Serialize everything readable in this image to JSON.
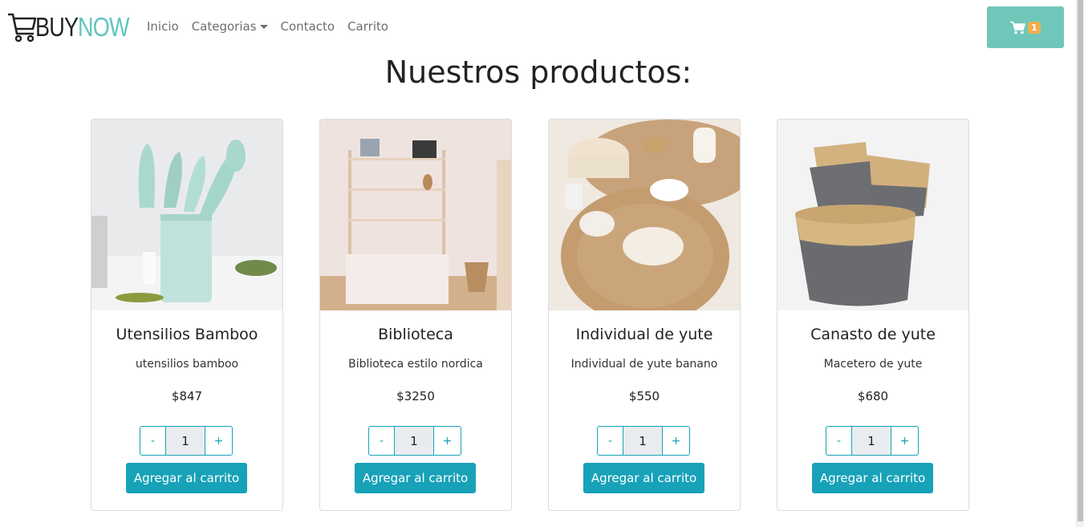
{
  "brand": {
    "word1": "BUY",
    "word2": "NOW"
  },
  "nav": {
    "inicio": "Inicio",
    "categorias": "Categorias",
    "contacto": "Contacto",
    "carrito": "Carrito"
  },
  "cart": {
    "count": "1",
    "icon": "shopping-cart-icon",
    "color": "#6fc7b9",
    "badge_color": "#f0ad4e"
  },
  "title": "Nuestros productos:",
  "products": [
    {
      "name": "Utensilios Bamboo",
      "description": "utensilios bamboo",
      "price": "$847",
      "quantity": "1",
      "add_label": "Agregar al carrito",
      "minus": "-",
      "plus": "+"
    },
    {
      "name": "Biblioteca",
      "description": "Biblioteca estilo nordica",
      "price": "$3250",
      "quantity": "1",
      "add_label": "Agregar al carrito",
      "minus": "-",
      "plus": "+"
    },
    {
      "name": "Individual de yute",
      "description": "Individual de yute banano",
      "price": "$550",
      "quantity": "1",
      "add_label": "Agregar al carrito",
      "minus": "-",
      "plus": "+"
    },
    {
      "name": "Canasto de yute",
      "description": "Macetero de yute",
      "price": "$680",
      "quantity": "1",
      "add_label": "Agregar al carrito",
      "minus": "-",
      "plus": "+"
    }
  ],
  "accent": "#17a2b8"
}
